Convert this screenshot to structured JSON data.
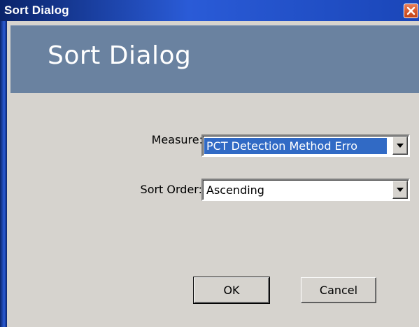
{
  "window": {
    "title": "Sort Dialog"
  },
  "header": {
    "title": "Sort Dialog"
  },
  "form": {
    "measure_label": "Measure:",
    "measure_value": "PCT Detection Method Erro",
    "sort_order_label": "Sort Order:",
    "sort_order_value": "Ascending"
  },
  "buttons": {
    "ok_label": "OK",
    "cancel_label": "Cancel"
  },
  "icons": {
    "close": "close-icon",
    "dropdown": "chevron-down-icon"
  },
  "colors": {
    "banner": "#6a82a0",
    "selection": "#316ac5",
    "dialog_bg": "#d6d3ce",
    "close_button": "#d65a2e"
  }
}
